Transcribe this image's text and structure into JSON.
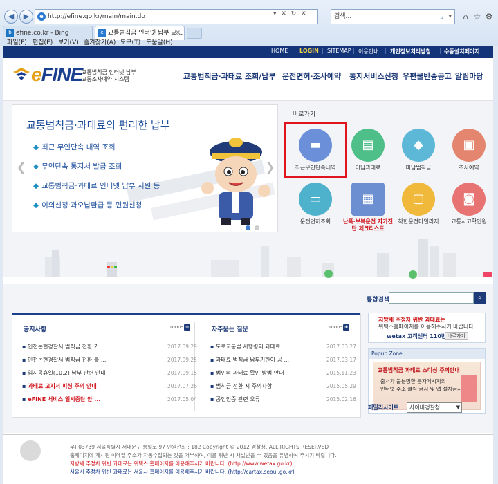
{
  "browser": {
    "url": "http://efine.go.kr/main/main.do",
    "search_placeholder": "검색...",
    "tabs": [
      {
        "label": "efine.co.kr - Bing"
      },
      {
        "label": "교통범칙금 인터넷 납부 교..."
      }
    ],
    "menu": [
      "파일(F)",
      "편집(E)",
      "보기(V)",
      "즐겨찾기(A)",
      "도구(T)",
      "도움말(H)"
    ]
  },
  "topbar": {
    "links": [
      "HOME",
      "LOGIN",
      "SITEMAP",
      "이용안내",
      "개인정보처리방침",
      "수동설치페이지"
    ]
  },
  "header": {
    "logo_text": "FINE",
    "logo_prefix": "e",
    "logo_sub1": "교통법칙금 인터넷 납부",
    "logo_sub2": "교통조사예약 시스템",
    "nav": [
      "교통범칙금·과태료 조회/납부",
      "운전면허·조사예약",
      "통지서비스신청",
      "우편물반송공고",
      "알림마당"
    ]
  },
  "banner": {
    "title": "교통범칙금·과태료의 편리한 납부",
    "items": [
      "최근 무인단속 내역 조회",
      "무인단속 통지서 발급 조회",
      "교통범칙금·과태료 인터넷 납부 지원 등",
      "이의신청·과오납환급 등 민원신청"
    ]
  },
  "quick": {
    "label": "바로가기",
    "items": [
      {
        "label": "최근무인단속내역",
        "color": "#6b8fd8",
        "icon": "camera-icon"
      },
      {
        "label": "미납과태료",
        "color": "#4fbf8a",
        "icon": "money-icon"
      },
      {
        "label": "미납범칙금",
        "color": "#5db8d8",
        "icon": "warning-icon"
      },
      {
        "label": "조사예약",
        "color": "#e4856f",
        "icon": "calendar-icon"
      },
      {
        "label": "운전면허조회",
        "color": "#4fb2cc",
        "icon": "license-icon"
      },
      {
        "label": "난폭·보복운전 자가진단 체크리스트",
        "color": "#6c8fd1",
        "icon": "checklist-icon",
        "red": true
      },
      {
        "label": "착한운전마일리지",
        "color": "#f1b93b",
        "icon": "mileage-icon"
      },
      {
        "label": "교통사고확인원",
        "color": "#e77373",
        "icon": "car-crash-icon"
      }
    ]
  },
  "search": {
    "label": "통합검색",
    "button": "🔍"
  },
  "notices": {
    "title": "공지사항",
    "more": "more",
    "rows": [
      {
        "text": "인천논현경찰서 범칙금 전환 가 ...",
        "date": "2017.09.29"
      },
      {
        "text": "인천논현경찰서 범칙금 전환 불 ...",
        "date": "2017.09.25"
      },
      {
        "text": "임시공휴일(10.2) 납부 관련 안내",
        "date": "2017.09.15"
      },
      {
        "text": "과태료 고지서 피싱 주의 안내",
        "date": "2017.07.26",
        "red": true
      },
      {
        "text": "eFINE 서비스 일시중단 안 ...",
        "date": "2017.05.04",
        "red": true
      }
    ]
  },
  "faq": {
    "title": "자주묻는 질문",
    "more": "more",
    "rows": [
      {
        "text": "도로교통법 시행령의 과태료 ...",
        "date": "2017.03.27"
      },
      {
        "text": "과태료·범칙금 납부기한이 공 ...",
        "date": "2017.03.17"
      },
      {
        "text": "법인의 과태료 확인 방법 안내",
        "date": "2015.11.23"
      },
      {
        "text": "범칙금 전환 시 주의사항",
        "date": "2015.05.29"
      },
      {
        "text": "공인인증 관련 오류",
        "date": "2015.02.16"
      }
    ]
  },
  "ad1": {
    "line1": "지방세 주정차 위반 과태료는",
    "line2": "위택스홈페이지를 이용해주시기 바랍니다.",
    "brand": "wetax 고객센터 110번",
    "button": "바로가기"
  },
  "popup": {
    "title": "Popup Zone",
    "line1": "교통범칙금 과태료 스미싱 주의안내",
    "line2": "출처가 불분명한 문자메시지의",
    "line3": "인터넷 주소 클릭 금지 및 앱 설치금지"
  },
  "family": {
    "label": "패밀리사이트",
    "selected": "사이버경찰청"
  },
  "footer": {
    "line1": "우) 03739 서울특별시 서대문구 통일로 97 민원전화 : 182     Copyright © 2012 경찰청. ALL RIGHTS RESERVED",
    "line2": "홈페이지에 게시된 이메일 주소가 자동수집되는 것을 거부하며, 이를 위반 시 처벌받을 수 있음을 유념하여 주시기 바랍니다.",
    "line3": "지방세 주정차 위반 과태료는 위택스 홈페이지를 이용해주시기 바랍니다. (http://www.wetax.go.kr)",
    "line4": "서울시 주정차 위반 과태료는 서울시 홈페이지를 이용해주시기 바랍니다. (http://cartax.seoul.go.kr)"
  },
  "colors": {
    "navy": "#14347a",
    "accent": "#e6a118",
    "highlight": "#e0141e"
  }
}
